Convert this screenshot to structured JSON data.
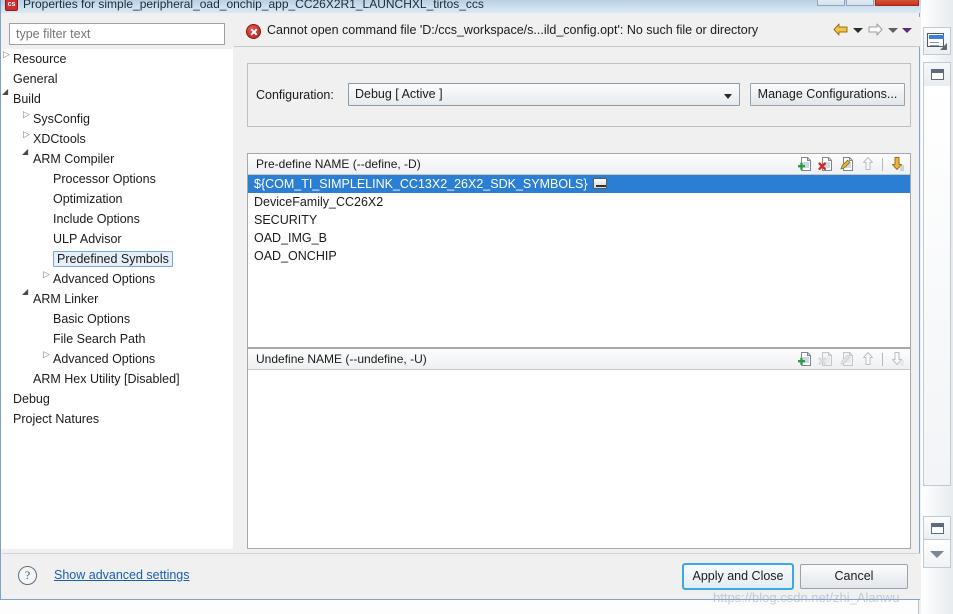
{
  "window": {
    "title": "Properties for simple_peripheral_oad_onchip_app_CC26X2R1_LAUNCHXL_tirtos_ccs",
    "app_icon": "ccs-app-icon",
    "minimize_label": "",
    "maximize_label": "",
    "close_label": ""
  },
  "filter": {
    "placeholder": "type filter text",
    "value": ""
  },
  "tree": {
    "items": [
      {
        "label": "Resource",
        "indent": 0,
        "marker": "collapsed",
        "selected": false
      },
      {
        "label": "General",
        "indent": 0,
        "marker": "none",
        "selected": false
      },
      {
        "label": "Build",
        "indent": 0,
        "marker": "expanded",
        "selected": false
      },
      {
        "label": "SysConfig",
        "indent": 1,
        "marker": "collapsed",
        "selected": false
      },
      {
        "label": "XDCtools",
        "indent": 1,
        "marker": "collapsed",
        "selected": false
      },
      {
        "label": "ARM Compiler",
        "indent": 1,
        "marker": "expanded",
        "selected": false
      },
      {
        "label": "Processor Options",
        "indent": 2,
        "marker": "none",
        "selected": false
      },
      {
        "label": "Optimization",
        "indent": 2,
        "marker": "none",
        "selected": false
      },
      {
        "label": "Include Options",
        "indent": 2,
        "marker": "none",
        "selected": false
      },
      {
        "label": "ULP Advisor",
        "indent": 2,
        "marker": "none",
        "selected": false
      },
      {
        "label": "Predefined Symbols",
        "indent": 2,
        "marker": "none",
        "selected": true
      },
      {
        "label": "Advanced Options",
        "indent": 2,
        "marker": "collapsed",
        "selected": false
      },
      {
        "label": "ARM Linker",
        "indent": 1,
        "marker": "expanded",
        "selected": false
      },
      {
        "label": "Basic Options",
        "indent": 2,
        "marker": "none",
        "selected": false
      },
      {
        "label": "File Search Path",
        "indent": 2,
        "marker": "none",
        "selected": false
      },
      {
        "label": "Advanced Options",
        "indent": 2,
        "marker": "collapsed",
        "selected": false
      },
      {
        "label": "ARM Hex Utility  [Disabled]",
        "indent": 1,
        "marker": "none",
        "selected": false
      },
      {
        "label": "Debug",
        "indent": 0,
        "marker": "none",
        "selected": false
      },
      {
        "label": "Project Natures",
        "indent": 0,
        "marker": "none",
        "selected": false
      }
    ]
  },
  "message": {
    "icon": "error-icon",
    "text": "Cannot open command file 'D:/ccs_workspace/s...ild_config.opt': No such file or directory",
    "severity_color": "#c0211c",
    "nav": {
      "back_icon": "back-arrow-icon",
      "back_menu_icon": "back-dropdown-caret",
      "forward_icon": "forward-arrow-icon",
      "forward_menu_icon": "forward-dropdown-caret",
      "overflow_icon": "overflow-caret"
    }
  },
  "configuration": {
    "label": "Configuration:",
    "selected": "Debug  [ Active ]",
    "options": [
      "Debug  [ Active ]"
    ],
    "manage_button": "Manage Configurations..."
  },
  "predefine": {
    "title": "Pre-define NAME (--define, -D)",
    "items": [
      {
        "text": "${COM_TI_SIMPLELINK_CC13X2_26X2_SDK_SYMBOLS}",
        "selected": true,
        "has_variable_chip": true
      },
      {
        "text": "DeviceFamily_CC26X2",
        "selected": false,
        "has_variable_chip": false
      },
      {
        "text": "SECURITY",
        "selected": false,
        "has_variable_chip": false
      },
      {
        "text": "OAD_IMG_B",
        "selected": false,
        "has_variable_chip": false
      },
      {
        "text": "OAD_ONCHIP",
        "selected": false,
        "has_variable_chip": false
      }
    ],
    "tools": [
      {
        "name": "add-icon",
        "enabled": true
      },
      {
        "name": "delete-icon",
        "enabled": true
      },
      {
        "name": "edit-icon",
        "enabled": true
      },
      {
        "name": "move-up-icon",
        "enabled": false
      },
      {
        "name": "move-down-icon",
        "enabled": true
      }
    ]
  },
  "undefine": {
    "title": "Undefine NAME (--undefine, -U)",
    "items": [],
    "tools": [
      {
        "name": "add-icon",
        "enabled": true
      },
      {
        "name": "delete-icon",
        "enabled": false
      },
      {
        "name": "edit-icon",
        "enabled": false
      },
      {
        "name": "move-up-icon",
        "enabled": false
      },
      {
        "name": "move-down-icon",
        "enabled": false
      }
    ]
  },
  "footer": {
    "help_icon": "help-icon",
    "help_glyph": "?",
    "advanced_link": "Show advanced settings",
    "apply_button": "Apply and Close",
    "cancel_button": "Cancel"
  },
  "watermark": {
    "text": "https://blog.csdn.net/zhi_Alanwu"
  },
  "colors": {
    "selection_blue": "#2a7fd4",
    "link_blue": "#1a5fb4",
    "error_red": "#c0211c",
    "focus_ring": "#3ea8e5"
  }
}
